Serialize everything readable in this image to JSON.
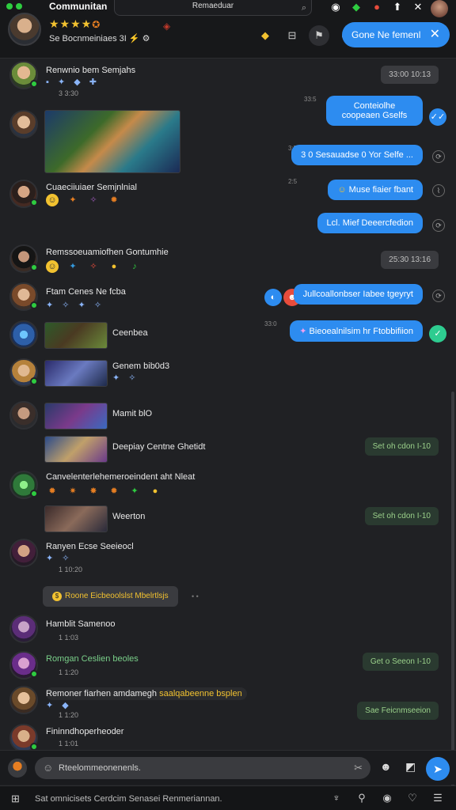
{
  "window": {
    "title": "Communitan"
  },
  "search": {
    "value": "Remaeduar"
  },
  "profile": {
    "stars": "★★★★",
    "stars_extra": "✪",
    "subtitle": "Se Bocnmeiniaes 3I ⚡ ⚙"
  },
  "toolbar": {
    "join_label": "Gone Ne femenl"
  },
  "messages": [
    {
      "name": "Renwnio bem Semjahs",
      "icons": "▪ ✦ ◆ ✚",
      "meta": "3 3:30",
      "time": "33:00 10:13"
    },
    {
      "bubble": "Conteiolhe coopeaen Gselfs",
      "time": "33:5"
    },
    {
      "bubble": "3 0  Sesauadse 0 Yor Selfe ...",
      "time": "3:5"
    },
    {
      "name": "Cuaeciiuiaer Semjnlnial"
    },
    {
      "bubble": "Muse fiaier fbant",
      "time": "2:5"
    },
    {
      "bubble": "Lcl. Mief   Deeercfedion"
    },
    {
      "name": "Remssoeuamiofhen Gontumhie",
      "time": "25:30 13:16"
    },
    {
      "name": "Ftam Cenes Ne fcba"
    },
    {
      "bubble": "Jullcoallonbser Iabee tgeyryt"
    },
    {
      "caption": "Ceenbea",
      "bubble": "Bieoealnilsim hr Ftobbifiion",
      "time": "33:0"
    },
    {
      "caption": "Genem bib0d3"
    },
    {
      "caption": "Mamit   blO"
    },
    {
      "caption": "Deepiay Centne Ghetidt",
      "time": "Set oh cdon  I-10"
    },
    {
      "name": "Canvelenterlehemeroeindent aht Nleat"
    },
    {
      "caption": "Weerton",
      "time": "Set oh cdon  I-10"
    },
    {
      "name": "Ranyen Ecse Seeieocl",
      "meta": "1 10:20"
    },
    {
      "system": "Roone Eicbeoolslst Mbelrtlsjs"
    },
    {
      "name": "Hamblit Samenoo",
      "meta": "1 1:03"
    },
    {
      "name": "Romgan Ceslien beoles",
      "meta": "1 1:20",
      "time": "Get o Seeon  I-10"
    },
    {
      "name": "Remoner fiarhen amdamegh",
      "highlight": "saalqabeenne bsplen",
      "meta": "1 1:20",
      "time": "Sae Feicnmseeion"
    },
    {
      "name": "Fininndhoperheoder",
      "meta": "1 1:01"
    }
  ],
  "composer": {
    "placeholder": "Rteelommeonenenls."
  },
  "footer": {
    "text": "Sat omnicisets  Cerdcim  Senasei Renmeriannan."
  }
}
